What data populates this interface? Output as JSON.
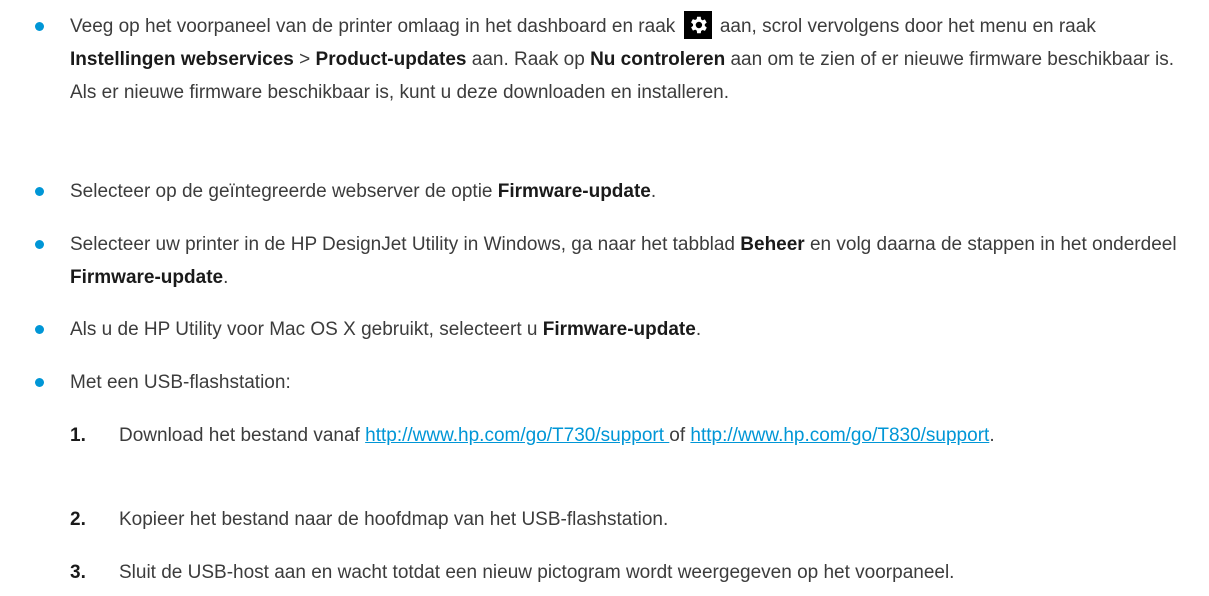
{
  "bullets": [
    {
      "t1": "Veeg op het voorpaneel van de printer omlaag in het dashboard en raak ",
      "icon": "settings-gear-icon",
      "t2": " aan, scrol vervolgens door het menu en raak ",
      "b1": "Instellingen webservices",
      "t3": " > ",
      "b2": "Product-updates",
      "t4": " aan. Raak op ",
      "b3": "Nu controleren",
      "t5": " aan om te zien of er nieuwe firmware beschikbaar is. Als er nieuwe firmware beschikbaar is, kunt u deze downloaden en installeren."
    },
    {
      "t1": "Selecteer op de geïntegreerde webserver de optie ",
      "b1": "Firmware-update",
      "t2": "."
    },
    {
      "t1": "Selecteer uw printer in de HP DesignJet Utility in Windows, ga naar het tabblad ",
      "b1": "Beheer",
      "t2": " en volg daarna de stappen in het onderdeel ",
      "b2": "Firmware-update",
      "t3": "."
    },
    {
      "t1": "Als u de HP Utility voor Mac OS X gebruikt, selecteert u ",
      "b1": "Firmware-update",
      "t2": "."
    },
    {
      "t1": "Met een USB-flashstation:"
    }
  ],
  "steps": [
    {
      "num": "1.",
      "t1": "Download het bestand vanaf ",
      "link1": "http://www.hp.com/go/T730/support ",
      "t2": "of ",
      "link2": "http://www.hp.com/go/T830/support",
      "t3": "."
    },
    {
      "num": "2.",
      "t1": "Kopieer het bestand naar de hoofdmap van het USB-flashstation."
    },
    {
      "num": "3.",
      "t1": "Sluit de USB-host aan en wacht totdat een nieuw pictogram wordt weergegeven op het voorpaneel."
    }
  ],
  "colors": {
    "bullet": "#0096d6",
    "link": "#0096d6",
    "text": "#3c3c3c"
  }
}
